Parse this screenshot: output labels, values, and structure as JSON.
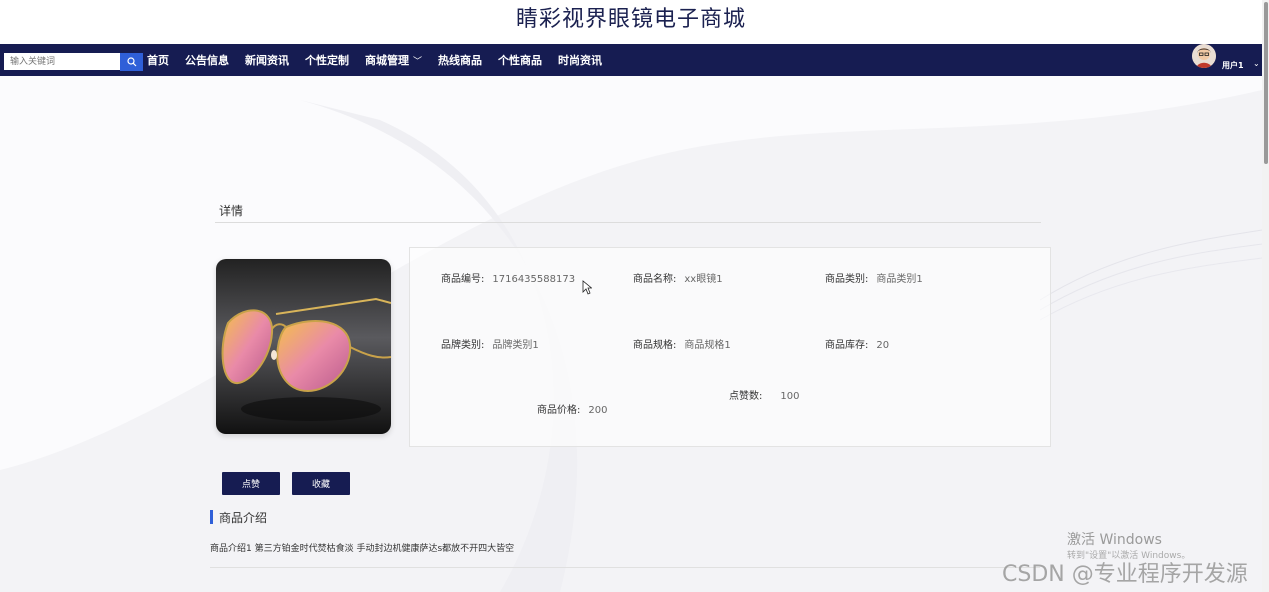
{
  "site": {
    "title": "睛彩视界眼镜电子商城"
  },
  "search": {
    "placeholder": "输入关键词"
  },
  "nav": {
    "items": [
      "首页",
      "公告信息",
      "新闻资讯",
      "个性定制",
      "商城管理",
      "热线商品",
      "个性商品",
      "时尚资讯"
    ],
    "dropdown_index": 4
  },
  "user": {
    "label": "用户1"
  },
  "detail": {
    "section_title": "详情"
  },
  "product": {
    "fields": [
      {
        "label": "商品编号:",
        "value": "1716435588173"
      },
      {
        "label": "商品名称:",
        "value": "xx眼镜1"
      },
      {
        "label": "商品类别:",
        "value": "商品类别1"
      },
      {
        "label": "品牌类别:",
        "value": "品牌类别1"
      },
      {
        "label": "商品规格:",
        "value": "商品规格1"
      },
      {
        "label": "商品库存:",
        "value": "20"
      },
      {
        "label": "点赞数:",
        "value": "100"
      },
      {
        "label": "商品价格:",
        "value": "200"
      }
    ]
  },
  "actions": {
    "like_label": "点赞",
    "favorite_label": "收藏"
  },
  "intro": {
    "title": "商品介绍",
    "text": "商品介绍1 第三方铂金时代焚枯食淡 手动封边机健康萨达s都放不开四大皆空"
  },
  "overlay": {
    "windows_line1": "激活 Windows",
    "windows_line2": "转到\"设置\"以激活 Windows。",
    "watermark": "CSDN @专业程序开发源"
  },
  "colors": {
    "nav_bg": "#161c52",
    "accent": "#2f5fd8"
  }
}
